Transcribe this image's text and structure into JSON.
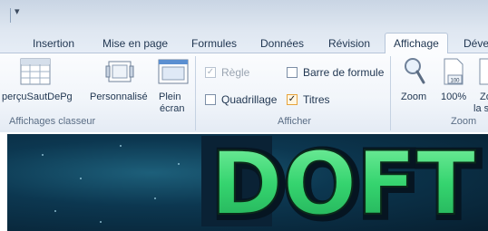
{
  "tabs": [
    {
      "label": "Insertion",
      "active": false
    },
    {
      "label": "Mise en page",
      "active": false
    },
    {
      "label": "Formules",
      "active": false
    },
    {
      "label": "Données",
      "active": false
    },
    {
      "label": "Révision",
      "active": false
    },
    {
      "label": "Affichage",
      "active": true
    },
    {
      "label": "Déve",
      "active": false
    }
  ],
  "groups": {
    "affichages_classeur": {
      "label": "Affichages classeur",
      "buttons": [
        {
          "label": "perçuSautDePg",
          "icon": "page-break-preview-icon"
        },
        {
          "label": "Personnalisé",
          "icon": "custom-views-icon"
        },
        {
          "label": "Plein",
          "label2": "écran",
          "icon": "full-screen-icon"
        }
      ]
    },
    "afficher": {
      "label": "Afficher",
      "checks": [
        {
          "label": "Règle",
          "checked": true,
          "disabled": true
        },
        {
          "label": "Barre de formule",
          "checked": false,
          "disabled": false
        },
        {
          "label": "Quadrillage",
          "checked": false,
          "disabled": false
        },
        {
          "label": "Titres",
          "checked": true,
          "disabled": false
        }
      ]
    },
    "zoom": {
      "label": "Zoom",
      "buttons": [
        {
          "label": "Zoom",
          "icon": "magnifier-icon"
        },
        {
          "label": "100%",
          "icon": "zoom-100-icon",
          "badge": "100"
        },
        {
          "label": "Zo",
          "label2": "la s",
          "icon": "zoom-selection-icon"
        }
      ]
    }
  },
  "banner": {
    "text": "DOFT",
    "colors": {
      "glow": "#5fe38a",
      "fill": "#2fcf6a",
      "dark": "#0a2e45"
    }
  },
  "colors": {
    "ribbon_bg": "#f1f5fa",
    "tab_active_bg": "#fbfcfe",
    "check_accent": "#e7a33a"
  }
}
